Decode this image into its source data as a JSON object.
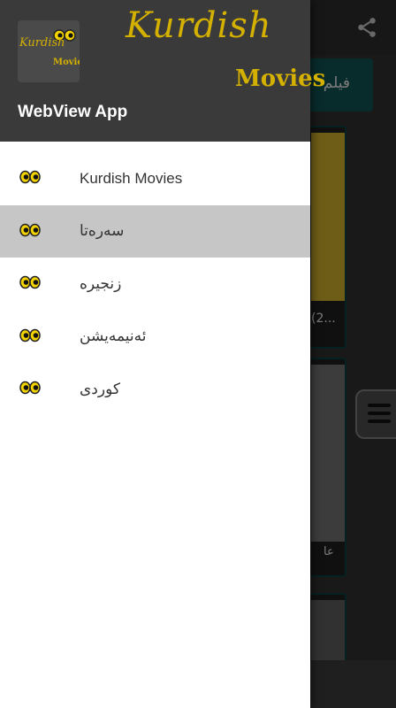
{
  "app": {
    "header_title": "WebView App",
    "logo": {
      "title": "Kurdish",
      "subtitle": "Movies"
    }
  },
  "background": {
    "tab_label": "فيلم",
    "card1_label": "(2...",
    "card2_label": "عا"
  },
  "menu": {
    "items": [
      {
        "label": "Kurdish Movies",
        "icon": "eyes-icon",
        "selected": false
      },
      {
        "label": "سەرەتا",
        "icon": "eyes-icon",
        "selected": true
      },
      {
        "label": "زنجیرە",
        "icon": "eyes-icon",
        "selected": false
      },
      {
        "label": "ئەنیمەیشن",
        "icon": "eyes-icon",
        "selected": false
      },
      {
        "label": "کوردی",
        "icon": "eyes-icon",
        "selected": false
      }
    ]
  },
  "colors": {
    "header_bg": "#3a3a3a",
    "logo_gold": "#d4b000",
    "selected_item_bg": "#c6c6c6",
    "tab_teal": "#0f4f4f"
  }
}
